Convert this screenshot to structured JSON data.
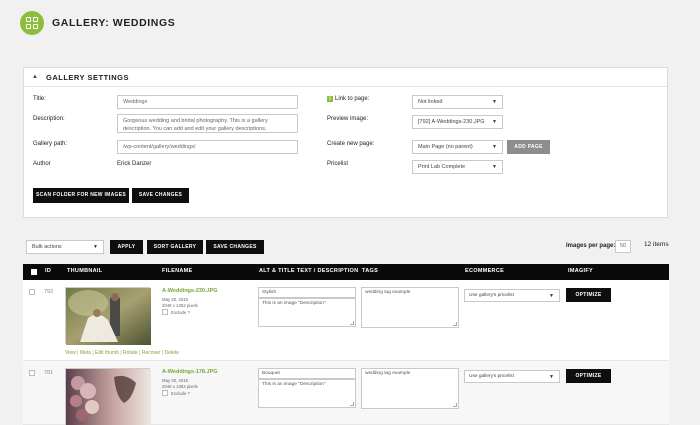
{
  "header": {
    "title": "GALLERY: WEDDINGS"
  },
  "settings": {
    "title": "GALLERY SETTINGS",
    "title_label": "Title:",
    "title_value": "Weddings",
    "description_label": "Description:",
    "description_value": "Gorgeous wedding and bridal photography. This is a gallery description. You can add and edit your gallery descriptions.",
    "path_label": "Gallery path:",
    "path_value": "/wp-content/gallery/weddings/",
    "author_label": "Author",
    "author_value": "Erick Danzer",
    "link_label": "Link to page:",
    "link_value": "Not linked",
    "preview_label": "Preview image:",
    "preview_value": "[792] A-Weddings-230.JPG",
    "create_label": "Create new page:",
    "create_value": "Main Page (no parent)",
    "add_page": "ADD PAGE",
    "pricelist_label": "Pricelist",
    "pricelist_value": "Print Lab Complete",
    "scan_button": "SCAN FOLDER FOR NEW IMAGES",
    "save_button": "SAVE CHANGES"
  },
  "toolbar": {
    "bulk_actions": "Bulk actions",
    "apply": "APPLY",
    "sort": "SORT GALLERY",
    "save": "SAVE CHANGES",
    "per_page_label": "Images per page:",
    "per_page_value": "50",
    "count": "12 items"
  },
  "table": {
    "headers": {
      "id": "ID",
      "thumbnail": "THUMBNAIL",
      "filename": "FILENAME",
      "alt": "ALT & TITLE TEXT / DESCRIPTION",
      "tags": "TAGS",
      "ecommerce": "ECOMMERCE",
      "imagify": "IMAGIFY"
    },
    "rows": [
      {
        "id": "792",
        "filename": "A-Weddings-230.JPG",
        "date": "May 30, 2016",
        "size": "2048 x 1363 pixels",
        "exclude": "Exclude ?",
        "alt": "Stylish",
        "description": "This is an image \"Description\"",
        "tags": "wedding tag example",
        "ecommerce": "Use gallery's pricelist",
        "optimize": "OPTIMIZE",
        "actions": [
          "View",
          "Meta",
          "Edit thumb",
          "Rotate",
          "Recover",
          "Delete"
        ]
      },
      {
        "id": "781",
        "filename": "A-Weddings-178.JPG",
        "date": "May 30, 2016",
        "size": "2048 x 1363 pixels",
        "exclude": "Exclude ?",
        "alt": "Bouquet",
        "description": "This is an image \"Description\"",
        "tags": "wedding tag example",
        "ecommerce": "Use gallery's pricelist",
        "optimize": "OPTIMIZE"
      }
    ]
  },
  "colors": {
    "accent": "#8cbd3f",
    "link": "#7aa534",
    "dark": "#0a0a0a"
  }
}
